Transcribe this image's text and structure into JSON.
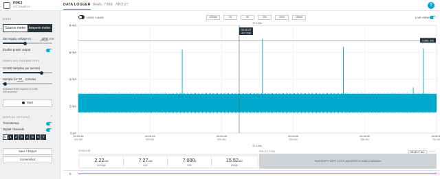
{
  "app": {
    "name": "PPK2",
    "serial": "E7C7EA9BC10"
  },
  "nav": {
    "tabs": [
      "DATA LOGGER",
      "REAL-TIME",
      "ABOUT"
    ],
    "help": "?"
  },
  "sidebar": {
    "mode_title": "MODE",
    "mode_options": [
      "Source meter",
      "Ampere meter"
    ],
    "supply_label": "Set supply voltage to",
    "supply_value": "3000",
    "supply_unit": "mV",
    "supply_fraction": 0.45,
    "power_label": "Enable power output",
    "sampling_title": "SAMPLING PARAMETERS",
    "rate_label": "10,000 samples per second",
    "rate_fraction": 0.78,
    "duration_prefix": "Sample for",
    "duration_value": "10",
    "duration_unit": "minutes",
    "duration_fraction": 0.05,
    "estimate_line1": "Estimated RAM required 24.0 MB",
    "estimate_line2": "100 us period",
    "start_label": "Start",
    "display_title": "DISPLAY OPTIONS",
    "timestamps_label": "Timestamps",
    "digital_label": "Digital channels",
    "channels": [
      "0",
      "1",
      "2",
      "3",
      "4",
      "5",
      "6",
      "7"
    ],
    "save_label": "Save / Export",
    "screenshot_label": "Screenshot"
  },
  "toolbar": {
    "lock_label": "LOCK Y-AXIS",
    "windows": [
      "100ms",
      "1s",
      "3s",
      "10s",
      "1min",
      "10min"
    ],
    "live_label": "LIVE VIEW"
  },
  "chart": {
    "window_label_top": "27.100s",
    "window_label_bottom": "27.100s",
    "cursor_time": "00:00:47",
    "cursor_value": "412.298",
    "peak_label": "6.861 mA",
    "y_unit_suffix": "μA"
  },
  "stats": {
    "window_title": "WINDOW",
    "selection_title": "SELECTION",
    "select_all": "SELECT ALL",
    "clear": "CLEAR",
    "hint": "Hold SHIFT+LEFT CLICK and DRAG to make a selection",
    "items": [
      {
        "value": "2.22",
        "unit": "mA",
        "label": "average"
      },
      {
        "value": "7.27",
        "unit": "mA",
        "label": "max"
      },
      {
        "value": "7.000",
        "unit": "s",
        "label": "time"
      },
      {
        "value": "15.52",
        "unit": "mC",
        "label": "charge"
      }
    ]
  },
  "digital_row_label": "0",
  "chart_data": {
    "type": "line",
    "xlabel": "",
    "ylabel": "",
    "y_ticks": [
      "8 mA",
      "6 mA",
      "4 mA",
      "2 mA",
      "0 μA"
    ],
    "ylim": [
      0,
      8
    ],
    "x_ticks": [
      {
        "time": "00:00:44",
        "sub": "241.000"
      },
      {
        "time": "00:00:46",
        "sub": "000.000"
      },
      {
        "time": "00:00:48",
        "sub": "000.000"
      },
      {
        "time": "00:00:50",
        "sub": "000.000"
      },
      {
        "time": "00:00:52",
        "sub": "000.000"
      },
      {
        "time": "00:00:54",
        "sub": "241.000"
      }
    ],
    "baseline_low": 1.55,
    "baseline_high": 2.9,
    "spikes": [
      {
        "x": 0.174,
        "y": 2.7
      },
      {
        "x": 0.29,
        "y": 6.2
      },
      {
        "x": 0.356,
        "y": 2.2
      },
      {
        "x": 0.383,
        "y": 2.0
      },
      {
        "x": 0.514,
        "y": 7.0
      },
      {
        "x": 0.59,
        "y": 2.3
      },
      {
        "x": 0.74,
        "y": 6.4
      },
      {
        "x": 0.846,
        "y": 2.7
      },
      {
        "x": 0.935,
        "y": 3.4
      },
      {
        "x": 0.949,
        "y": 2.0
      },
      {
        "x": 0.963,
        "y": 6.3
      }
    ]
  }
}
